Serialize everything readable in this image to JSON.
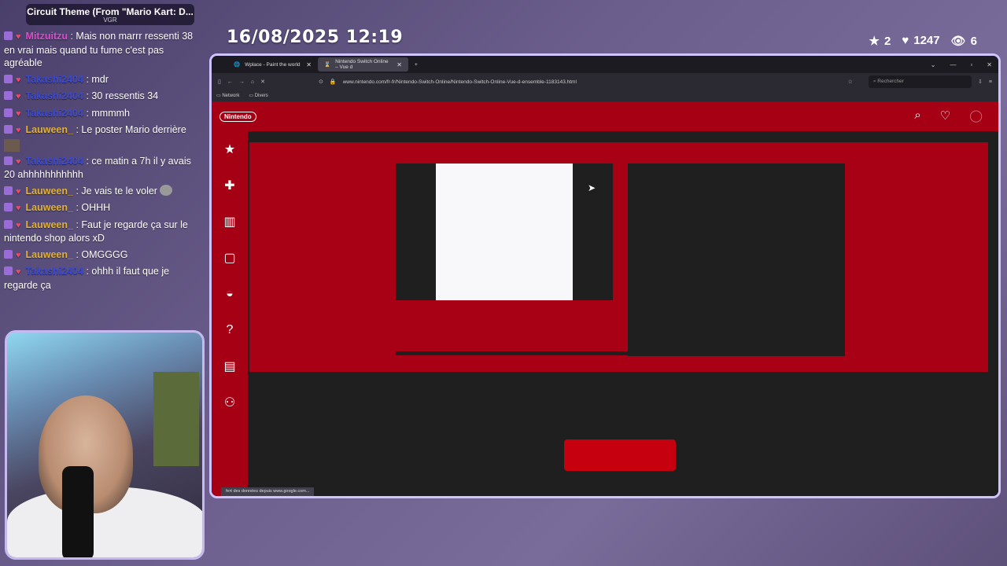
{
  "music": {
    "title": "Circuit Theme (From \"Mario Kart: D...",
    "artist": "VGR"
  },
  "chat": [
    {
      "user": "Mitzuitzu",
      "cls": "u-mitz",
      "text": ": Mais non marrr ressenti 38 en vrai mais quand tu fume c'est pas agréable"
    },
    {
      "user": "Takashi2404",
      "cls": "u-taka",
      "text": ": mdr"
    },
    {
      "user": "Takashi2404",
      "cls": "u-taka",
      "text": ": 30 ressentis 34"
    },
    {
      "user": "Takashi2404",
      "cls": "u-taka",
      "text": ": mmmmh"
    },
    {
      "user": "Lauween_",
      "cls": "u-lauw",
      "text": ": Le poster Mario derrière"
    },
    {
      "user": "Takashi2404",
      "cls": "u-taka",
      "text": ": ce matin a 7h il y avais 20 ahhhhhhhhhhh"
    },
    {
      "user": "Lauween_",
      "cls": "u-lauw",
      "text": ": Je vais te le voler"
    },
    {
      "user": "Lauween_",
      "cls": "u-lauw",
      "text": ": OHHH"
    },
    {
      "user": "Lauween_",
      "cls": "u-lauw",
      "text": ": Faut je regarde ça sur le nintendo shop alors xD"
    },
    {
      "user": "Lauween_",
      "cls": "u-lauw",
      "text": ": OMGGGG"
    },
    {
      "user": "Takashi2404",
      "cls": "u-taka",
      "text": ": ohhh il faut que je regarde ça"
    }
  ],
  "datetime": "16/08/2025 12:19",
  "stats": {
    "stars": "2",
    "hearts": "1247",
    "viewers": "6"
  },
  "browser": {
    "tab1": "Wplace - Paint the world",
    "tab2": "Nintendo Switch Online – Vue d",
    "url": "www.nintendo.com/fr-fr/Nintendo-Switch-Online/Nintendo-Switch-Online-Vue-d-ensemble-1183143.html",
    "search_placeholder": "Rechercher",
    "bookmark1": "Network",
    "bookmark2": "Divers",
    "status": "fert des données depuis www.google.com..."
  },
  "site": {
    "logo": "Nintendo"
  },
  "icons": [
    "star-icon",
    "controller-icon",
    "switch-icon",
    "bag-icon",
    "mario-icon",
    "question-icon",
    "news-icon",
    "people-icon"
  ]
}
